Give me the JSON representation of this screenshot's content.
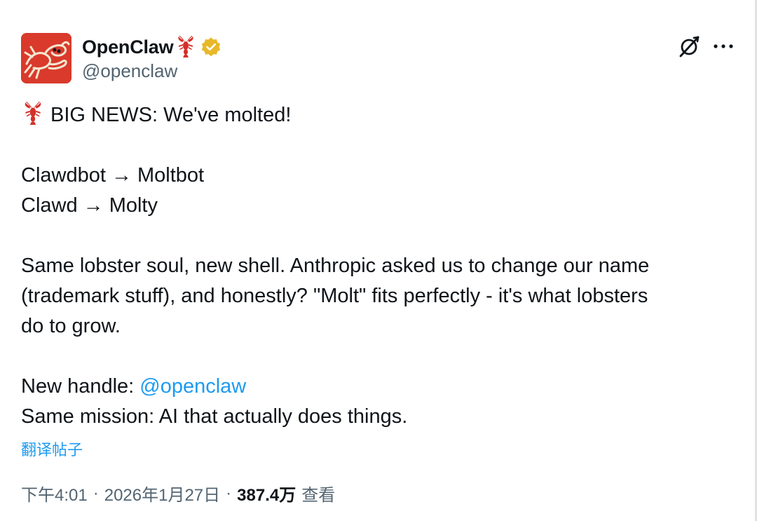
{
  "author": {
    "name": "OpenClaw",
    "handle": "@openclaw",
    "name_emoji": "lobster-icon",
    "verified": true,
    "verified_color": "#e8b829"
  },
  "header_actions": {
    "grok_icon": "grok-icon",
    "more_icon": "more-horizontal-icon"
  },
  "tweet": {
    "line1": "BIG NEWS: We've molted!",
    "line1_emoji": "lobster-icon",
    "rename1": "Clawdbot → Moltbot",
    "rename2": "Clawd → Molty",
    "paragraph": [
      "Same lobster soul, new shell. Anthropic asked us to change our name",
      "(trademark stuff), and honestly? \"Molt\" fits perfectly - it's what lobsters",
      "do to grow."
    ],
    "handle_prefix": "New handle: ",
    "handle_mention": "@openclaw",
    "mission": "Same mission: AI that actually does things."
  },
  "translate_label": "翻译帖子",
  "meta": {
    "time": "下午4:01",
    "separator": "·",
    "date": "2026年1月27日",
    "views_count": "387.4万",
    "views_label": "查看"
  },
  "colors": {
    "accent": "#1d9bf0",
    "text": "#0f1419",
    "secondary": "#536471",
    "avatar_bg": "#d93a2b"
  }
}
